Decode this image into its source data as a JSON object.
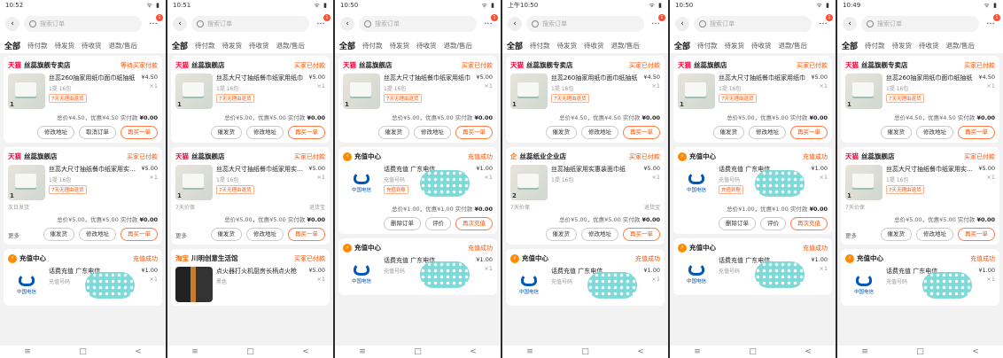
{
  "colors": {
    "accent": "#ff5000",
    "tmall": "#ff0036",
    "badge": "#ff4d2d",
    "telecom": "#0057b8"
  },
  "common": {
    "search_placeholder": "搜索订单",
    "more_icon": "more-icon",
    "badge": "1",
    "tabs": [
      "全部",
      "待付款",
      "待发货",
      "待收货",
      "退款/售后"
    ],
    "nav": [
      "≡",
      "□",
      "<"
    ]
  },
  "phones": [
    {
      "time": "10:52",
      "status_icons": "ᯤ ▮",
      "cards": [
        {
          "type": "goods",
          "badge": "天猫",
          "shop": "丝蕊旗舰专卖店",
          "status": "等待买家付款",
          "title": "丝蕊260抽家用纸巾面巾纸抽纸",
          "sub": "1提 16包",
          "tag": "7天无理由退货",
          "price": "¥4.50",
          "qty": "×1",
          "thumb_num": "1",
          "total": "总价¥4.50，优惠¥4.50 实付款",
          "pay": "¥0.00",
          "more": "",
          "buttons": [
            "修改地址",
            "取消订单",
            "再买一单"
          ]
        },
        {
          "type": "goods",
          "badge": "天猫",
          "shop": "丝蕊旗舰店",
          "status": "买家已付款",
          "title": "丝蕊大尺寸抽纸餐巾纸家用实惠装",
          "sub": "1提 16包",
          "tag": "7天无理由退货",
          "price": "¥5.00",
          "qty": "×1",
          "thumb_num": "1",
          "meta_left": "次日发货",
          "meta_right": "",
          "total": "总价¥5.00，优惠¥5.00 实付款",
          "pay": "¥0.00",
          "more": "更多",
          "buttons": [
            "催发货",
            "修改地址",
            "再买一单"
          ]
        },
        {
          "type": "recharge",
          "badge": "",
          "shop": "充值中心",
          "status": "充值成功",
          "title": "话费充值 广东电信",
          "sub": "充值号码",
          "tag": "",
          "price": "¥1.00",
          "qty": "×1",
          "thumb_num": "",
          "total": "",
          "pay": "",
          "more": "",
          "buttons": []
        }
      ]
    },
    {
      "time": "10:51",
      "status_icons": "ᯤ ▮",
      "cards": [
        {
          "type": "goods",
          "badge": "天猫",
          "shop": "丝蕊旗舰店",
          "status": "买家已付款",
          "title": "丝蕊大尺寸抽纸餐巾纸家用纸巾",
          "sub": "1提 16包",
          "tag": "7天无理由退货",
          "price": "¥5.00",
          "qty": "×1",
          "thumb_num": "1",
          "total": "总价¥5.00，优惠¥5.00 实付款",
          "pay": "¥0.00",
          "more": "",
          "buttons": [
            "催发货",
            "修改地址",
            "再买一单"
          ]
        },
        {
          "type": "goods",
          "badge": "天猫",
          "shop": "丝蕊旗舰店",
          "status": "买家已付款",
          "title": "丝蕊大尺寸抽纸餐巾纸家用实惠装",
          "sub": "1提 16包",
          "tag": "7天无理由退货",
          "price": "¥5.00",
          "qty": "×1",
          "thumb_num": "1",
          "meta_left": "7天价保",
          "meta_right": "退货宝",
          "total": "总价¥5.00，优惠¥5.00 实付款",
          "pay": "¥0.00",
          "more": "更多",
          "buttons": [
            "催发货",
            "修改地址",
            "再买一单"
          ]
        },
        {
          "type": "product",
          "badge": "淘宝",
          "shop": "川明创意生活馆",
          "status": "买家已付款",
          "title": "点火器打火机厨房长柄点火枪",
          "sub": "黑色",
          "tag": "",
          "price": "¥5.00",
          "qty": "×1",
          "thumb_num": "",
          "total": "",
          "pay": "",
          "more": "",
          "buttons": []
        }
      ]
    },
    {
      "time": "10:50",
      "status_icons": "ᯤ ▮",
      "cards": [
        {
          "type": "goods",
          "badge": "天猫",
          "shop": "丝蕊旗舰店",
          "status": "买家已付款",
          "title": "丝蕊大尺寸抽纸餐巾纸家用纸巾",
          "sub": "1提 16包",
          "tag": "7天无理由退货",
          "price": "¥5.00",
          "qty": "×1",
          "thumb_num": "1",
          "total": "总价¥5.00，优惠¥5.00 实付款",
          "pay": "¥0.00",
          "more": "",
          "buttons": [
            "催发货",
            "修改地址",
            "再买一单"
          ]
        },
        {
          "type": "recharge",
          "badge": "",
          "shop": "充值中心",
          "status": "充值成功",
          "title": "话费充值 广东电信",
          "sub": "充值号码",
          "tag": "充值到账",
          "price": "¥1.00",
          "qty": "×1",
          "thumb_num": "",
          "total": "总价¥1.00，优惠¥1.00 实付款",
          "pay": "¥0.00",
          "more": "",
          "buttons": [
            "删除订单",
            "评价",
            "再次充值"
          ]
        },
        {
          "type": "recharge",
          "badge": "",
          "shop": "充值中心",
          "status": "充值成功",
          "title": "话费充值 广东电信",
          "sub": "充值号码",
          "tag": "",
          "price": "¥1.00",
          "qty": "×1",
          "thumb_num": "",
          "total": "",
          "pay": "",
          "more": "",
          "buttons": []
        }
      ]
    },
    {
      "time": "上午10:50",
      "status_icons": "ᯤ ▮",
      "cards": [
        {
          "type": "goods",
          "badge": "天猫",
          "shop": "丝蕊旗舰专卖店",
          "status": "买家已付款",
          "title": "丝蕊260抽家用纸巾面巾纸抽纸",
          "sub": "1提 16包",
          "tag": "7天无理由退货",
          "price": "¥4.50",
          "qty": "×1",
          "thumb_num": "1",
          "total": "总价¥4.50，优惠¥4.50 实付款",
          "pay": "¥0.00",
          "more": "",
          "buttons": [
            "催发货",
            "修改地址",
            "再买一单"
          ]
        },
        {
          "type": "goods",
          "badge": "企",
          "shop": "丝蕊纸业企业店",
          "status": "买家已付款",
          "title": "丝蕊抽纸家用实惠装面巾纸",
          "sub": "1提 16包",
          "tag": "",
          "price": "¥5.00",
          "qty": "×1",
          "thumb_num": "2",
          "meta_left": "7天价保",
          "meta_right": "退货宝",
          "total": "总价¥5.00，优惠¥5.00 实付款",
          "pay": "¥0.00",
          "more": "",
          "buttons": [
            "催发货",
            "修改地址",
            "再买一单"
          ]
        },
        {
          "type": "recharge",
          "badge": "",
          "shop": "充值中心",
          "status": "充值成功",
          "title": "话费充值 广东电信",
          "sub": "充值号码",
          "tag": "",
          "price": "¥1.00",
          "qty": "×1",
          "thumb_num": "",
          "total": "",
          "pay": "",
          "more": "",
          "buttons": []
        }
      ]
    },
    {
      "time": "10:50",
      "status_icons": "ᯤ ▮",
      "cards": [
        {
          "type": "goods",
          "badge": "天猫",
          "shop": "丝蕊旗舰店",
          "status": "买家已付款",
          "title": "丝蕊大尺寸抽纸餐巾纸家用纸巾",
          "sub": "1提 16包",
          "tag": "7天无理由退货",
          "price": "¥5.00",
          "qty": "×1",
          "thumb_num": "1",
          "total": "总价¥5.00，优惠¥5.00 实付款",
          "pay": "¥0.00",
          "more": "",
          "buttons": [
            "催发货",
            "修改地址",
            "再买一单"
          ]
        },
        {
          "type": "recharge",
          "badge": "",
          "shop": "充值中心",
          "status": "充值成功",
          "title": "话费充值 广东电信",
          "sub": "充值号码",
          "tag": "充值到账",
          "price": "¥1.00",
          "qty": "×1",
          "thumb_num": "",
          "total": "总价¥1.00，优惠¥1.00 实付款",
          "pay": "¥0.00",
          "more": "",
          "buttons": [
            "删除订单",
            "评价",
            "再次充值"
          ]
        },
        {
          "type": "recharge",
          "badge": "",
          "shop": "充值中心",
          "status": "充值成功",
          "title": "话费充值 广东电信",
          "sub": "充值号码",
          "tag": "",
          "price": "¥1.00",
          "qty": "×1",
          "thumb_num": "",
          "total": "",
          "pay": "",
          "more": "",
          "buttons": []
        }
      ]
    },
    {
      "time": "10:49",
      "status_icons": "ᯤ ▮",
      "cards": [
        {
          "type": "goods",
          "badge": "天猫",
          "shop": "丝蕊旗舰专卖店",
          "status": "买家已付款",
          "title": "丝蕊260抽家用纸巾面巾纸抽纸",
          "sub": "1提 16包",
          "tag": "7天无理由退货",
          "price": "¥4.50",
          "qty": "×1",
          "thumb_num": "1",
          "total": "总价¥4.50，优惠¥4.50 实付款",
          "pay": "¥0.00",
          "more": "",
          "buttons": [
            "催发货",
            "修改地址",
            "再买一单"
          ]
        },
        {
          "type": "goods",
          "badge": "天猫",
          "shop": "丝蕊旗舰店",
          "status": "买家已付款",
          "title": "丝蕊大尺寸抽纸餐巾纸家用实惠装",
          "sub": "1提 16包",
          "tag": "7天无理由退货",
          "price": "¥5.00",
          "qty": "×1",
          "thumb_num": "1",
          "meta_left": "7天价保",
          "meta_right": "",
          "total": "总价¥5.00，优惠¥5.00 实付款",
          "pay": "¥0.00",
          "more": "更多",
          "buttons": [
            "催发货",
            "修改地址",
            "再买一单"
          ]
        },
        {
          "type": "recharge",
          "badge": "",
          "shop": "充值中心",
          "status": "充值成功",
          "title": "话费充值 广东电信",
          "sub": "充值号码",
          "tag": "",
          "price": "¥1.00",
          "qty": "×1",
          "thumb_num": "",
          "total": "",
          "pay": "",
          "more": "",
          "buttons": []
        }
      ]
    }
  ]
}
